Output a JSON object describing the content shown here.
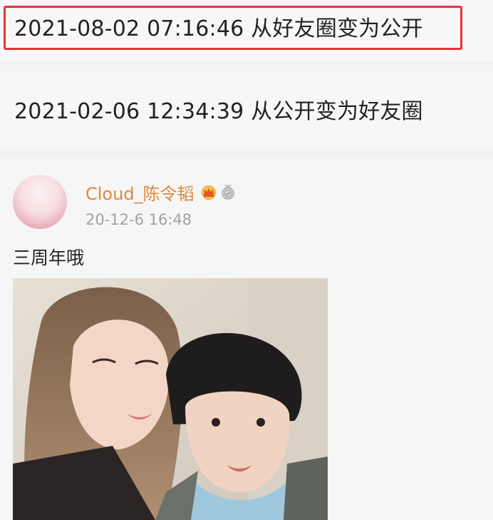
{
  "log": {
    "entries": [
      {
        "text": "2021-08-02 07:16:46 从好友圈变为公开",
        "highlighted": true,
        "highlight_color": "#e8323b"
      },
      {
        "text": "2021-02-06 12:34:39 从公开变为好友圈",
        "highlighted": false
      }
    ]
  },
  "post": {
    "username": "Cloud_陈令韬",
    "username_color": "#e0893a",
    "badges": [
      "crown-icon",
      "medal-icon"
    ],
    "time": "20-12-6 16:48",
    "text": "三周年哦",
    "image": "photo of two people taking a selfie"
  }
}
